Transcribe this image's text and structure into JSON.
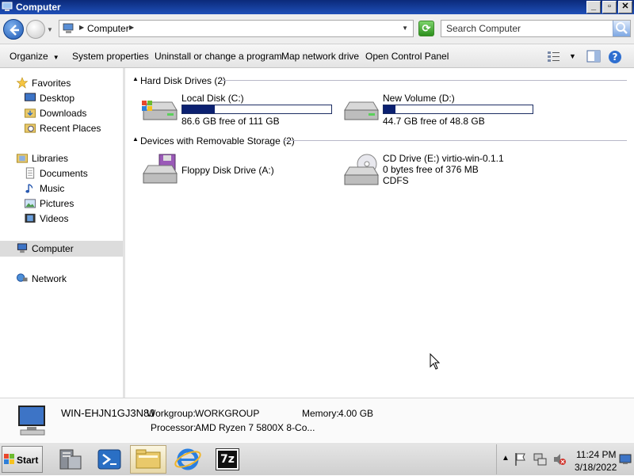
{
  "window": {
    "title": "Computer",
    "minimize": "_",
    "maximize": "▫",
    "close": "✕"
  },
  "address": {
    "location": "Computer",
    "search_placeholder": "Search Computer"
  },
  "toolbar": {
    "organize": "Organize",
    "system_properties": "System properties",
    "uninstall": "Uninstall or change a program",
    "map_drive": "Map network drive",
    "control_panel": "Open Control Panel"
  },
  "sidebar": {
    "favorites": "Favorites",
    "desktop": "Desktop",
    "downloads": "Downloads",
    "recent": "Recent Places",
    "libraries": "Libraries",
    "documents": "Documents",
    "music": "Music",
    "pictures": "Pictures",
    "videos": "Videos",
    "computer": "Computer",
    "network": "Network"
  },
  "groups": {
    "hdd": "Hard Disk Drives (2)",
    "removable": "Devices with Removable Storage (2)"
  },
  "drives": {
    "c": {
      "name": "Local Disk (C:)",
      "free": "86.6 GB free of 111 GB",
      "used_fraction": 0.22
    },
    "d": {
      "name": "New Volume (D:)",
      "free": "44.7 GB free of 48.8 GB",
      "used_fraction": 0.08
    },
    "a": {
      "name": "Floppy Disk Drive (A:)"
    },
    "e": {
      "name": "CD Drive (E:) virtio-win-0.1.1",
      "line2": "0 bytes free of 376 MB",
      "line3": "CDFS"
    }
  },
  "details": {
    "computer_name": "WIN-EHJN1GJ3N8J",
    "workgroup_label": "Workgroup:",
    "workgroup": "WORKGROUP",
    "memory_label": "Memory:",
    "memory": "4.00 GB",
    "processor_label": "Processor:",
    "processor": "AMD Ryzen 7 5800X 8-Co..."
  },
  "taskbar": {
    "start": "Start",
    "time": "11:24 PM",
    "date": "3/18/2022",
    "sevenzip": "7z"
  }
}
